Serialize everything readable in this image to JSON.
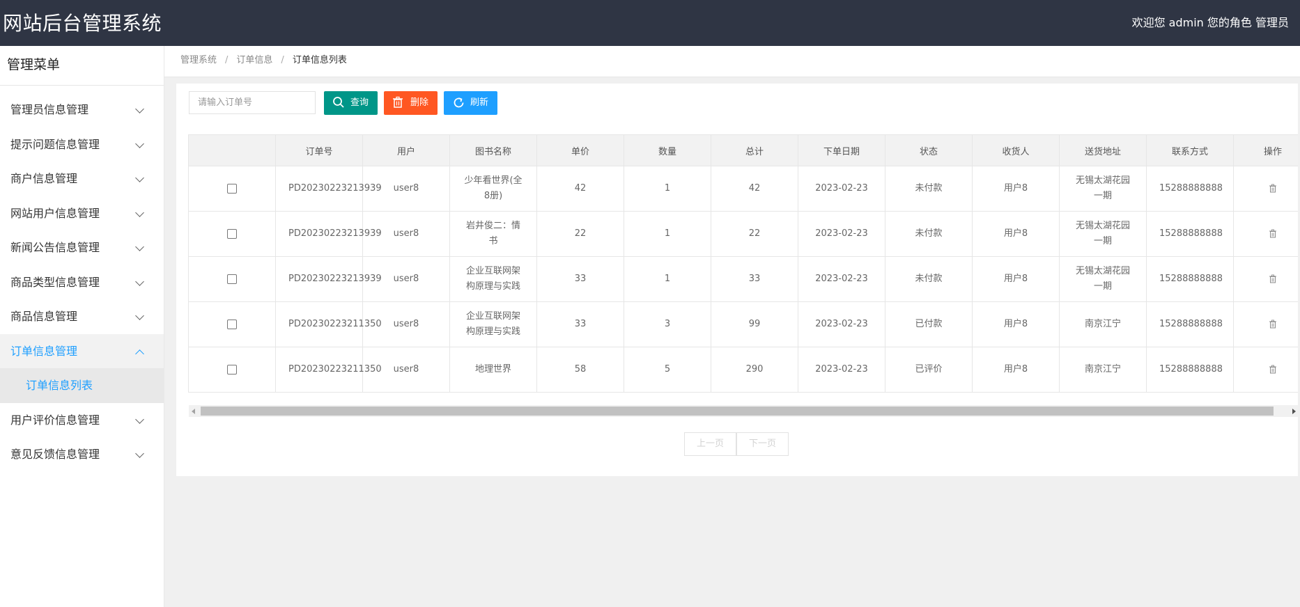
{
  "header": {
    "title": "网站后台管理系统",
    "welcome": "欢迎您 admin 您的角色 管理员"
  },
  "sidebar": {
    "title": "管理菜单",
    "items": [
      {
        "label": "管理员信息管理"
      },
      {
        "label": "提示问题信息管理"
      },
      {
        "label": "商户信息管理"
      },
      {
        "label": "网站用户信息管理"
      },
      {
        "label": "新闻公告信息管理"
      },
      {
        "label": "商品类型信息管理"
      },
      {
        "label": "商品信息管理"
      },
      {
        "label": "订单信息管理",
        "expanded": true,
        "children": [
          {
            "label": "订单信息列表"
          }
        ]
      },
      {
        "label": "用户评价信息管理"
      },
      {
        "label": "意见反馈信息管理"
      }
    ]
  },
  "breadcrumb": [
    "管理系统",
    "订单信息",
    "订单信息列表"
  ],
  "toolbar": {
    "search_placeholder": "请输入订单号",
    "query_label": "查询",
    "delete_label": "删除",
    "refresh_label": "刷新"
  },
  "table": {
    "columns": [
      "",
      "订单号",
      "用户",
      "图书名称",
      "单价",
      "数量",
      "总计",
      "下单日期",
      "状态",
      "收货人",
      "送货地址",
      "联系方式",
      "操作"
    ],
    "rows": [
      {
        "order_no": "PD20230223213939",
        "user": "user8",
        "book": "少年看世界(全8册)",
        "price": "42",
        "qty": "1",
        "total": "42",
        "date": "2023-02-23",
        "status": "未付款",
        "receiver": "用户8",
        "address": "无锡太湖花园一期",
        "phone": "15288888888"
      },
      {
        "order_no": "PD20230223213939",
        "user": "user8",
        "book": "岩井俊二：情书",
        "price": "22",
        "qty": "1",
        "total": "22",
        "date": "2023-02-23",
        "status": "未付款",
        "receiver": "用户8",
        "address": "无锡太湖花园一期",
        "phone": "15288888888"
      },
      {
        "order_no": "PD20230223213939",
        "user": "user8",
        "book": "企业互联网架构原理与实践",
        "price": "33",
        "qty": "1",
        "total": "33",
        "date": "2023-02-23",
        "status": "未付款",
        "receiver": "用户8",
        "address": "无锡太湖花园一期",
        "phone": "15288888888"
      },
      {
        "order_no": "PD20230223211350",
        "user": "user8",
        "book": "企业互联网架构原理与实践",
        "price": "33",
        "qty": "3",
        "total": "99",
        "date": "2023-02-23",
        "status": "已付款",
        "receiver": "用户8",
        "address": "南京江宁",
        "phone": "15288888888"
      },
      {
        "order_no": "PD20230223211350",
        "user": "user8",
        "book": "地理世界",
        "price": "58",
        "qty": "5",
        "total": "290",
        "date": "2023-02-23",
        "status": "已评价",
        "receiver": "用户8",
        "address": "南京江宁",
        "phone": "15288888888"
      }
    ]
  },
  "pager": {
    "prev_label": "上一页",
    "next_label": "下一页"
  },
  "colors": {
    "header_bg": "#2f3544",
    "accent": "#1e9fff",
    "query": "#009688",
    "delete": "#ff5722",
    "refresh": "#1e9fff"
  },
  "icons": {
    "query": "search-icon",
    "delete": "trash-icon",
    "refresh": "refresh-icon",
    "row_action": "trash-icon"
  }
}
